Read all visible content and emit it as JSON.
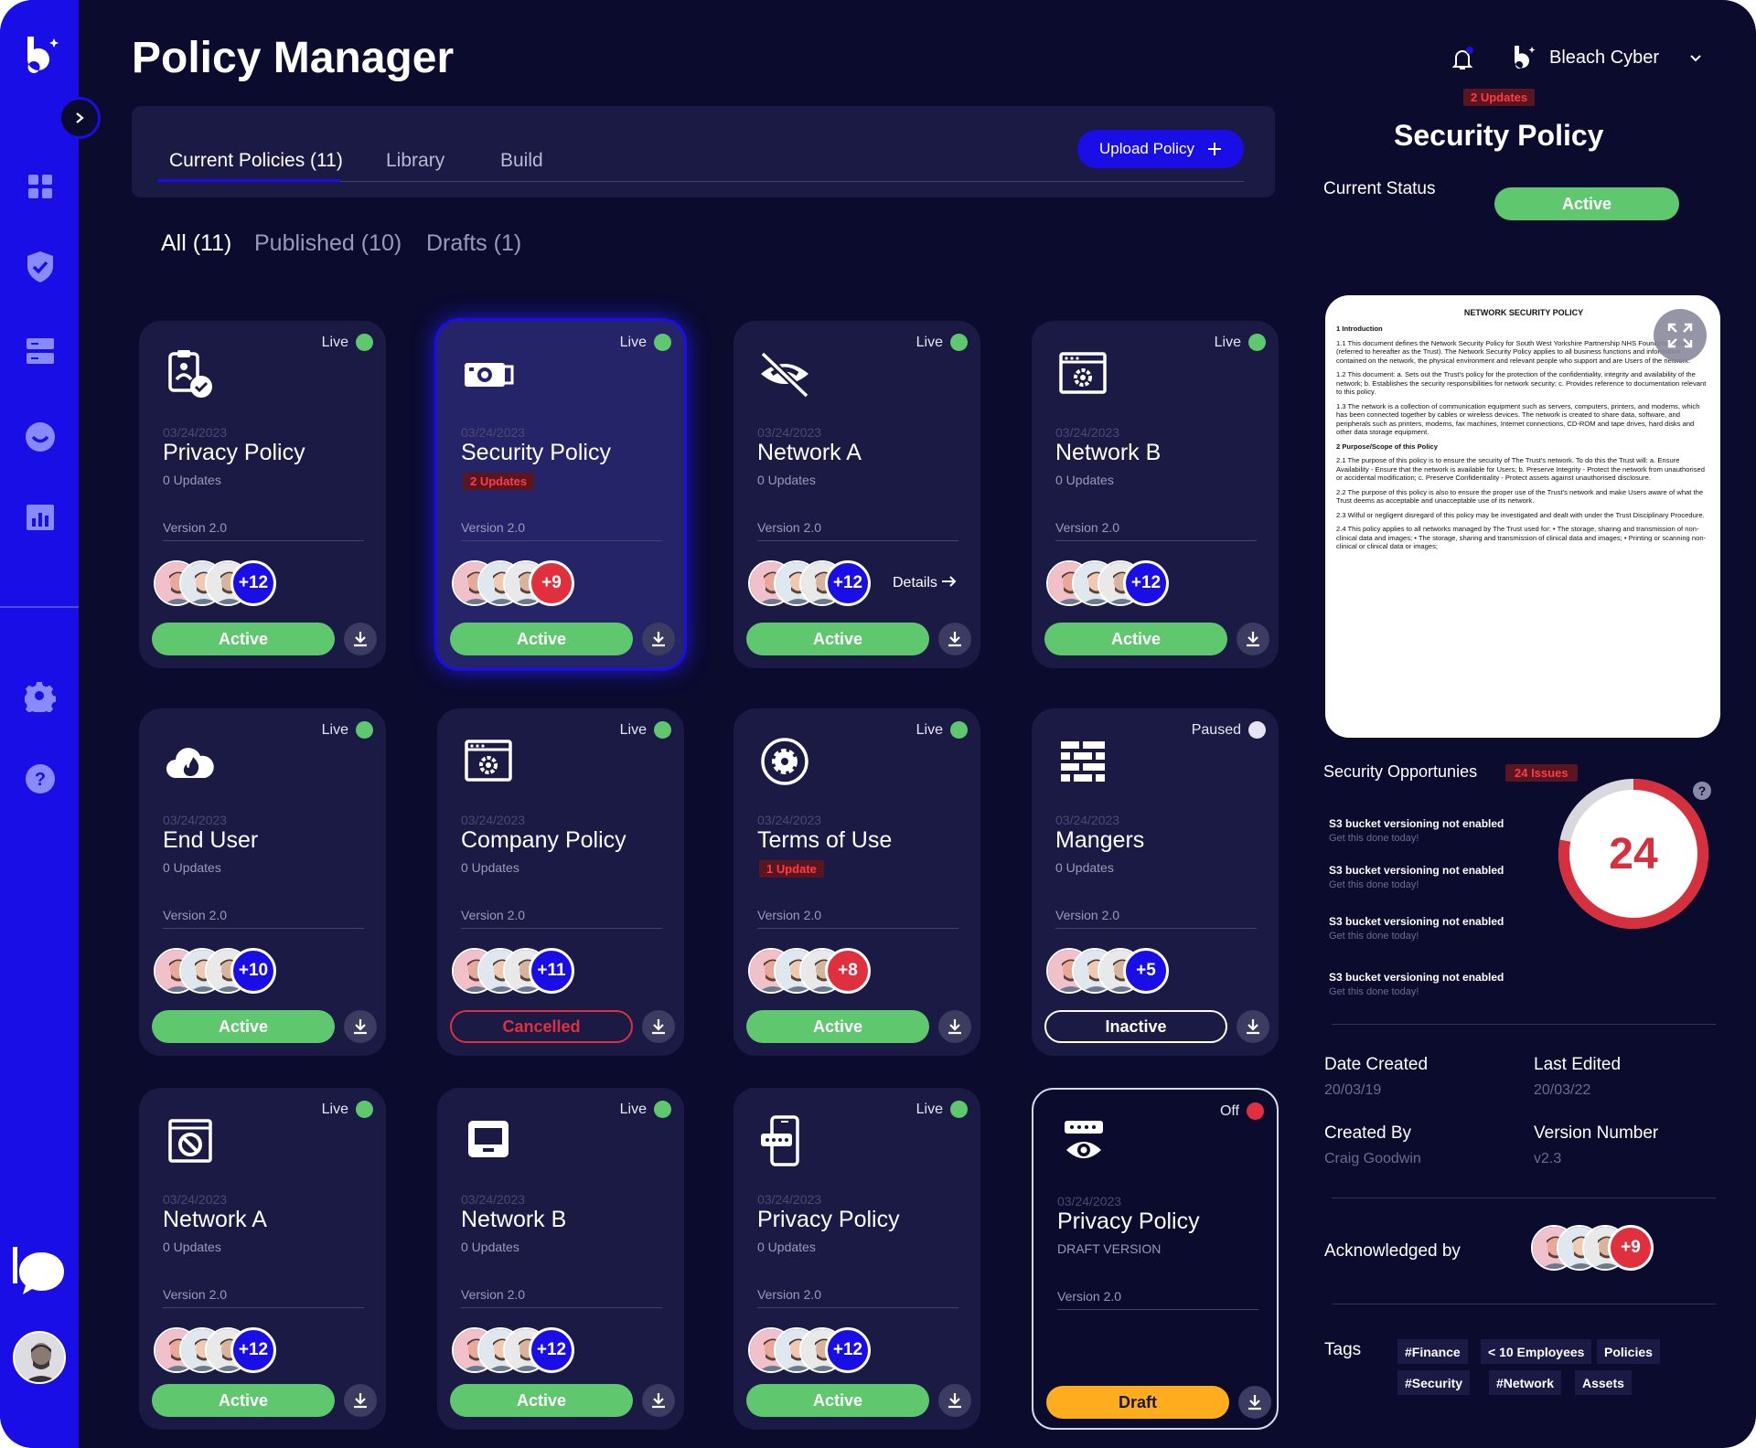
{
  "brand": {
    "initial": "b",
    "accent": "#1a0ee6"
  },
  "header": {
    "title": "Policy Manager",
    "account_name": "Bleach Cyber",
    "updates_badge": "2 Updates"
  },
  "tabs": [
    {
      "label": "Current Policies (11)"
    },
    {
      "label": "Library"
    },
    {
      "label": "Build"
    }
  ],
  "upload_label": "Upload Policy",
  "filters": [
    {
      "label": "All (11)"
    },
    {
      "label": "Published (10)"
    },
    {
      "label": "Drafts (1)"
    }
  ],
  "sidebar": {
    "icons": [
      "grid-icon",
      "shield-icon",
      "server-icon",
      "smile-icon",
      "chart-icon",
      "gear-icon",
      "help-icon"
    ]
  },
  "cards": [
    {
      "icon": "clipboard-check-icon",
      "status": "Live",
      "status_color": "#5fc86f",
      "date": "03/24/2023",
      "title": "Privacy Policy",
      "sub": "0 Updates",
      "badge": "",
      "version": "Version 2.0",
      "more": "+12",
      "more_color": "#1a0ee6",
      "details": "",
      "pill": "Active",
      "pill_kind": "active"
    },
    {
      "icon": "camera-icon",
      "status": "Live",
      "status_color": "#5fc86f",
      "date": "03/24/2023",
      "title": "Security Policy",
      "sub": "",
      "badge": "2 Updates",
      "version": "Version 2.0",
      "more": "+9",
      "more_color": "#e0303e",
      "details": "",
      "pill": "Active",
      "pill_kind": "active"
    },
    {
      "icon": "eye-off-icon",
      "status": "Live",
      "status_color": "#5fc86f",
      "date": "03/24/2023",
      "title": "Network A",
      "sub": "0 Updates",
      "badge": "",
      "version": "Version 2.0",
      "more": "+12",
      "more_color": "#1a0ee6",
      "details": "Details",
      "pill": "Active",
      "pill_kind": "active"
    },
    {
      "icon": "browser-gear-icon",
      "status": "Live",
      "status_color": "#5fc86f",
      "date": "03/24/2023",
      "title": "Network B",
      "sub": "0 Updates",
      "badge": "",
      "version": "Version 2.0",
      "more": "+12",
      "more_color": "#1a0ee6",
      "details": "",
      "pill": "Active",
      "pill_kind": "active"
    },
    {
      "icon": "cloud-fire-icon",
      "status": "Live",
      "status_color": "#5fc86f",
      "date": "03/24/2023",
      "title": "End User",
      "sub": "0 Updates",
      "badge": "",
      "version": "Version 2.0",
      "more": "+10",
      "more_color": "#1a0ee6",
      "details": "",
      "pill": "Active",
      "pill_kind": "active"
    },
    {
      "icon": "browser-gear-icon",
      "status": "Live",
      "status_color": "#5fc86f",
      "date": "03/24/2023",
      "title": "Company Policy",
      "sub": "0 Updates",
      "badge": "",
      "version": "Version 2.0",
      "more": "+11",
      "more_color": "#1a0ee6",
      "details": "",
      "pill": "Cancelled",
      "pill_kind": "cancelled"
    },
    {
      "icon": "gear-badge-icon",
      "status": "Live",
      "status_color": "#5fc86f",
      "date": "03/24/2023",
      "title": "Terms of Use",
      "sub": "",
      "badge": "1 Update",
      "version": "Version 2.0",
      "more": "+8",
      "more_color": "#e0303e",
      "details": "",
      "pill": "Active",
      "pill_kind": "active"
    },
    {
      "icon": "firewall-icon",
      "status": "Paused",
      "status_color": "#e6e6f2",
      "date": "03/24/2023",
      "title": "Mangers",
      "sub": "0 Updates",
      "badge": "",
      "version": "Version 2.0",
      "more": "+5",
      "more_color": "#1a0ee6",
      "details": "",
      "pill": "Inactive",
      "pill_kind": "inactive"
    },
    {
      "icon": "block-window-icon",
      "status": "Live",
      "status_color": "#5fc86f",
      "date": "03/24/2023",
      "title": "Network A",
      "sub": "0 Updates",
      "badge": "",
      "version": "Version 2.0",
      "more": "+12",
      "more_color": "#1a0ee6",
      "details": "",
      "pill": "Active",
      "pill_kind": "active"
    },
    {
      "icon": "monitor-icon",
      "status": "Live",
      "status_color": "#5fc86f",
      "date": "03/24/2023",
      "title": "Network B",
      "sub": "0 Updates",
      "badge": "",
      "version": "Version 2.0",
      "more": "+12",
      "more_color": "#1a0ee6",
      "details": "",
      "pill": "Active",
      "pill_kind": "active"
    },
    {
      "icon": "phone-password-icon",
      "status": "Live",
      "status_color": "#5fc86f",
      "date": "03/24/2023",
      "title": "Privacy Policy",
      "sub": "0 Updates",
      "badge": "",
      "version": "Version 2.0",
      "more": "+12",
      "more_color": "#1a0ee6",
      "details": "",
      "pill": "Active",
      "pill_kind": "active"
    },
    {
      "icon": "password-eye-icon",
      "status": "Off",
      "status_color": "#e0303e",
      "date": "03/24/2023",
      "title": "Privacy Policy",
      "sub": "DRAFT VERSION",
      "badge": "",
      "version": "Version 2.0",
      "more": "",
      "more_color": "",
      "details": "",
      "pill": "Draft",
      "pill_kind": "draftp"
    }
  ],
  "panel": {
    "title": "Security Policy",
    "status_label": "Current Status",
    "status": "Active",
    "document": {
      "title": "NETWORK SECURITY POLICY",
      "lines": [
        "1     Introduction",
        "1.1  This document defines the Network Security Policy for South West Yorkshire Partnership NHS Foundation Trust (referred to hereafter as the Trust). The Network Security Policy applies to all business functions and information contained on the network, the physical environment and relevant people who support and are Users of the network.",
        "1.2  This document: a. Sets out the Trust's policy for the protection of the confidentiality, integrity and availability of the network; b. Establishes the security responsibilities for network security; c. Provides reference to documentation relevant to this policy.",
        "1.3  The network is a collection of communication equipment such as servers, computers, printers, and modems, which has been connected together by cables or wireless devices. The network is created to share data, software, and peripherals such as printers, modems, fax machines, Internet connections, CD-ROM and tape drives, hard disks and other data storage equipment.",
        "2     Purpose/Scope of this Policy",
        "2.1  The purpose of this policy is to ensure the security of The Trust's network. To do this the Trust will: a. Ensure Availability - Ensure that the network is available for Users; b. Preserve Integrity - Protect the network from unauthorised or accidental modification; c. Preserve Confidentiality - Protect assets against unauthorised disclosure.",
        "2.2  The purpose of this policy is also to ensure the proper use of the Trust's network and make Users aware of what the Trust deems as acceptable and unacceptable use of its network.",
        "2.3  Wilful or negligent disregard of this policy may be investigated and dealt with under the Trust Disciplinary Procedure.",
        "2.4  This policy applies to all networks managed by The Trust used for: • The storage, sharing and transmission of non-clinical data and images; • The storage, sharing and transmission of clinical data and images; • Printing or scanning non-clinical or clinical data or images;"
      ]
    },
    "opportunities_label": "Security Opportunies",
    "issues_badge": "24 Issues",
    "issues_count": "24",
    "issues_fraction": 0.78,
    "opportunities": [
      {
        "title": "S3 bucket versioning not enabled",
        "sub": "Get this done today!"
      },
      {
        "title": "S3 bucket versioning not enabled",
        "sub": "Get this done today!"
      },
      {
        "title": "S3 bucket versioning not enabled",
        "sub": "Get this done today!"
      },
      {
        "title": "S3 bucket versioning not enabled",
        "sub": "Get this done today!"
      }
    ],
    "date_created_label": "Date Created",
    "date_created": "20/03/19",
    "last_edited_label": "Last Edited",
    "last_edited": "20/03/22",
    "created_by_label": "Created By",
    "created_by": "Craig Goodwin",
    "version_label": "Version Number",
    "version": "v2.3",
    "ack_label": "Acknowledged by",
    "ack_more": "+9",
    "tags_label": "Tags",
    "tags": [
      "#Finance",
      "< 10 Employees",
      "Policies",
      "#Security",
      "#Network",
      "Assets"
    ]
  }
}
